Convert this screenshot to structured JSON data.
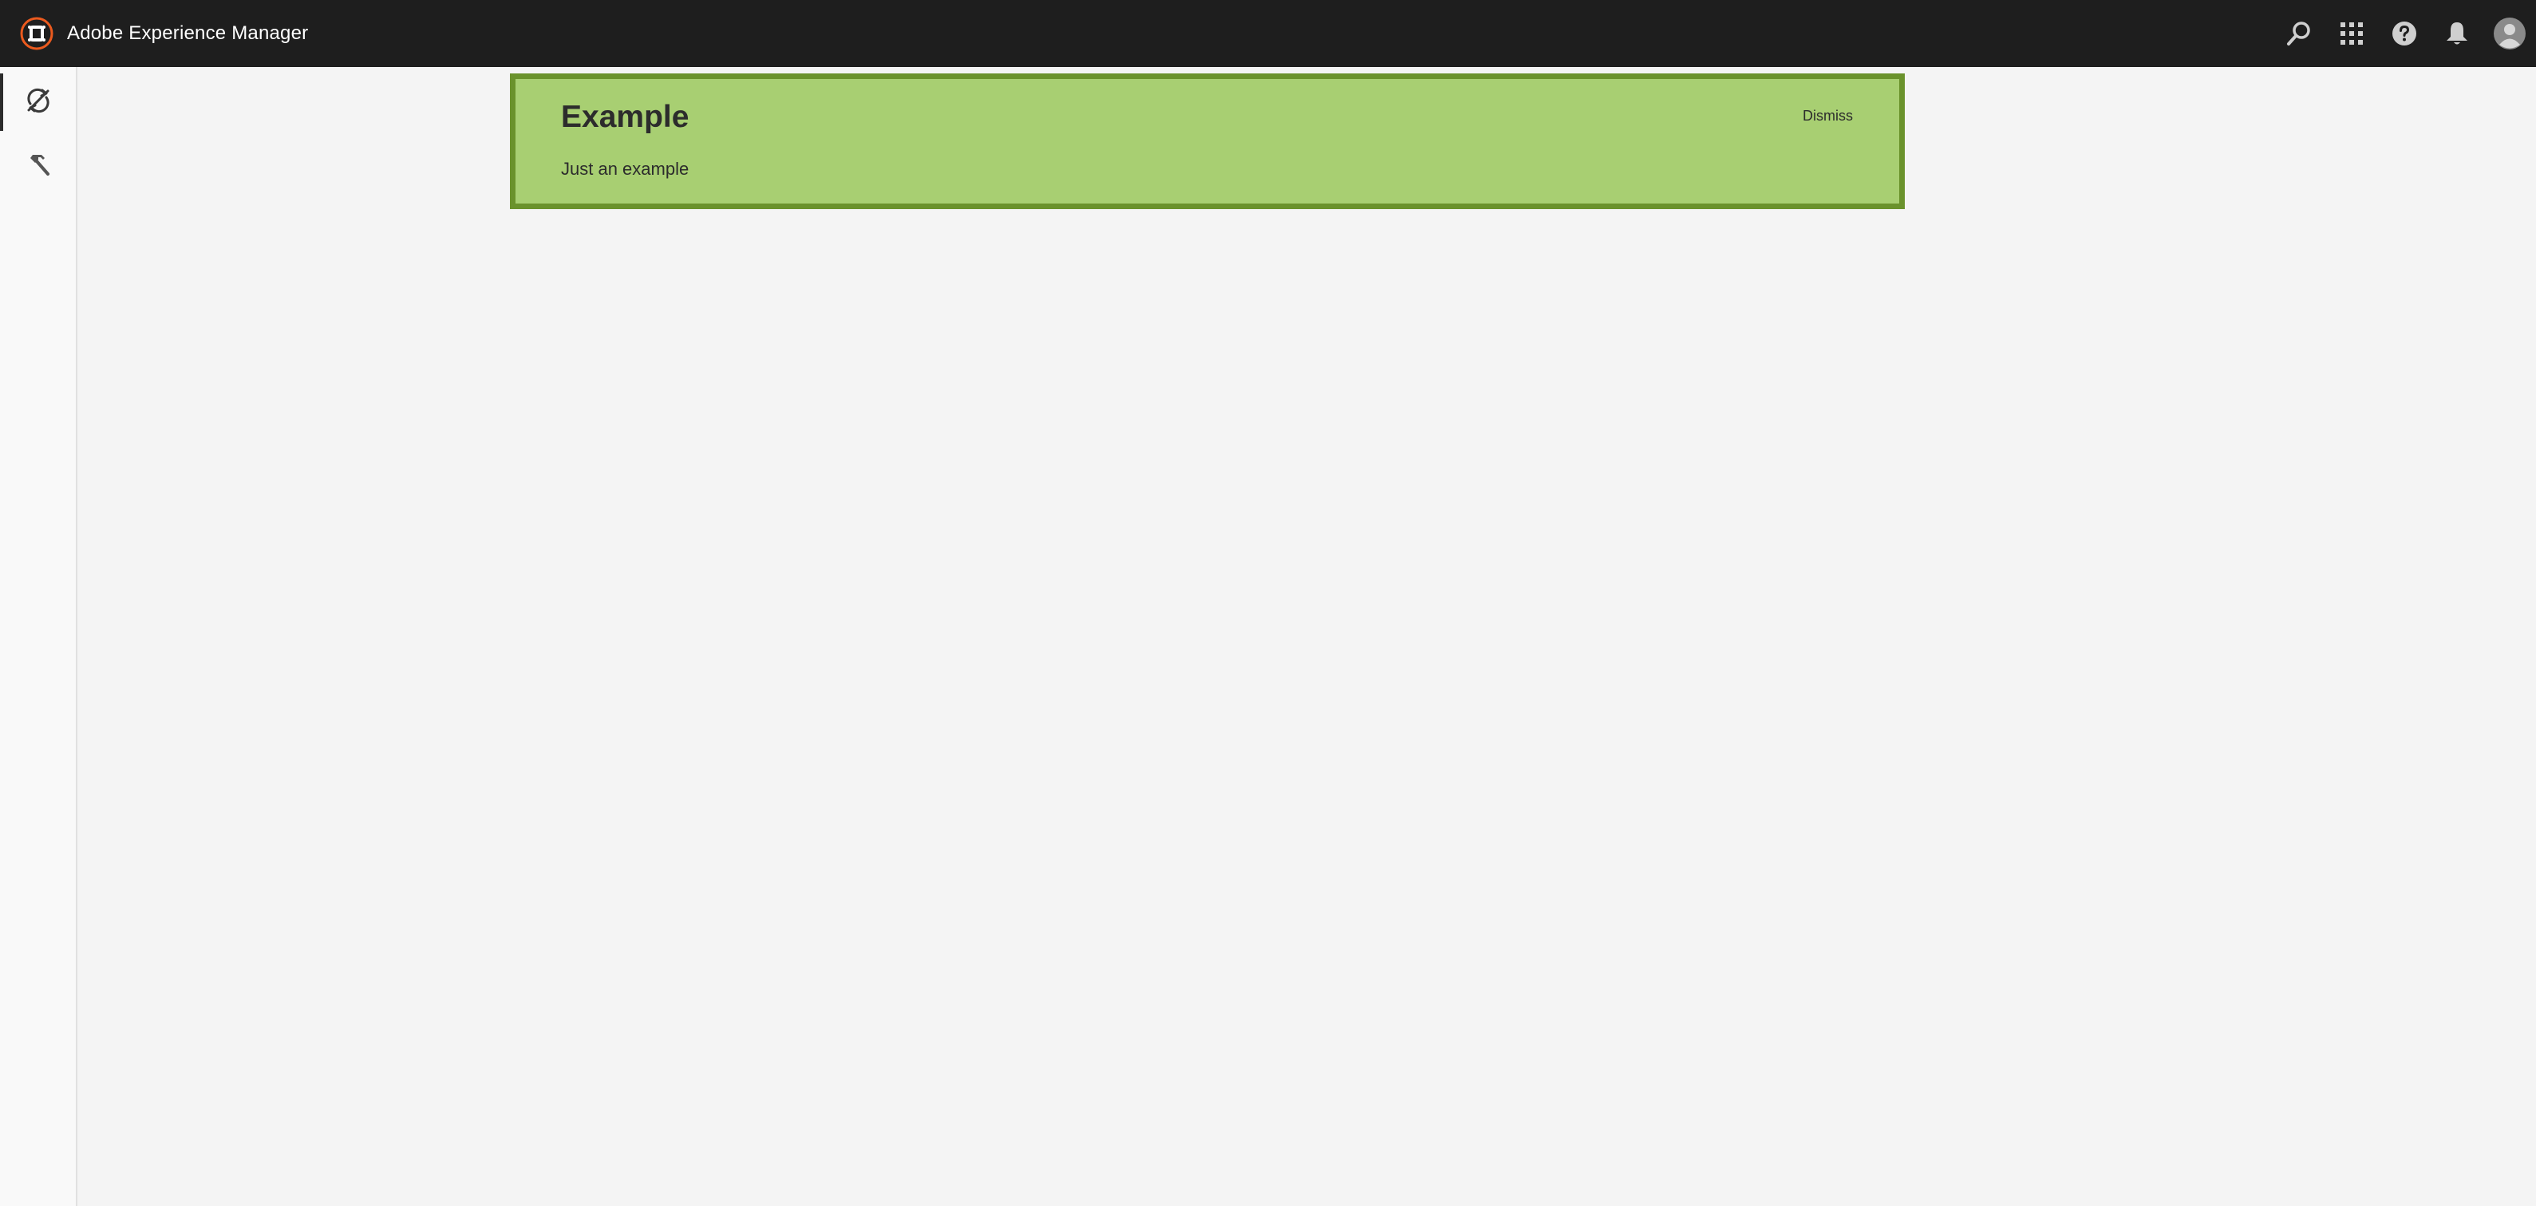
{
  "header": {
    "app_title": "Adobe Experience Manager",
    "logo_icon": "adobe-experience-manager-logo",
    "actions": [
      {
        "name": "search",
        "icon": "search-icon"
      },
      {
        "name": "solutions",
        "icon": "grid-icon"
      },
      {
        "name": "help",
        "icon": "help-icon"
      },
      {
        "name": "notifications",
        "icon": "bell-icon"
      },
      {
        "name": "user",
        "icon": "avatar-icon"
      }
    ]
  },
  "rail": {
    "items": [
      {
        "icon": "sync-icon",
        "active": true
      },
      {
        "icon": "hammer-icon",
        "active": false
      }
    ]
  },
  "notice": {
    "title": "Example",
    "message": "Just an example",
    "dismiss_label": "Dismiss"
  },
  "colors": {
    "header_bg": "#1e1e1e",
    "logo_accent": "#eb5a1e",
    "notice_bg": "#a8cf72",
    "notice_border": "#6a922c",
    "content_bg": "#f4f4f4"
  }
}
